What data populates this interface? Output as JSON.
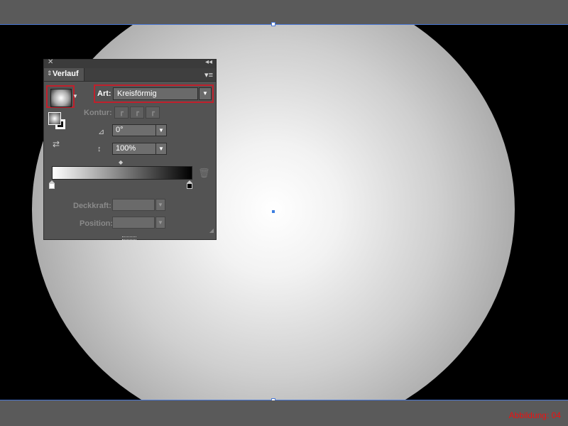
{
  "panel": {
    "close_glyph": "✕",
    "collapse_glyph": "◂◂",
    "tab_arrows": "⇕",
    "tab_label": "Verlauf",
    "menu_glyph": "▾≡",
    "art_label": "Art:",
    "art_value": "Kreisförmig",
    "kontur_label": "Kontur:",
    "angle_value": "0°",
    "aspect_value": "100%",
    "deckkraft_label": "Deckkraft:",
    "position_label": "Position:",
    "dropdown_glyph": "▼"
  },
  "icons": {
    "angle": "⊿",
    "aspect": "↕",
    "reverse": "⇄",
    "trash": "🗑",
    "midpoint": "◆"
  },
  "colors": {
    "highlight": "#c0202c",
    "selection": "#4a78d6",
    "caption": "#e11111"
  },
  "gradient": {
    "stops": [
      "#ffffff",
      "#000000"
    ]
  },
  "caption": "Abbildung: 04"
}
